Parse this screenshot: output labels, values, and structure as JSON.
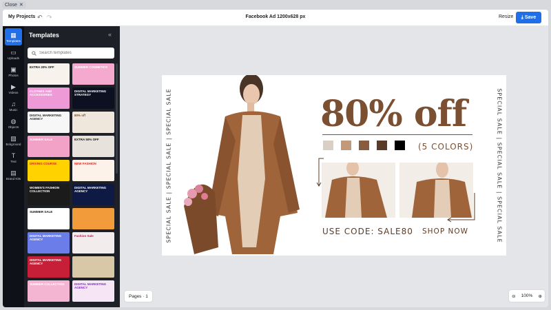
{
  "overlay": {
    "close_label": "Close",
    "close_icon": "close-icon"
  },
  "topbar": {
    "my_projects": "My Projects",
    "doc_title": "Facebook Ad 1200x628 px",
    "resize_label": "Resize",
    "save_label": "Save",
    "accent": "#1f6feb"
  },
  "rail": {
    "items": [
      {
        "label": "Templates",
        "icon": "grid-icon"
      },
      {
        "label": "Uploads",
        "icon": "folder-icon"
      },
      {
        "label": "Photos",
        "icon": "image-icon"
      },
      {
        "label": "Videos",
        "icon": "play-icon"
      },
      {
        "label": "Music",
        "icon": "music-icon"
      },
      {
        "label": "Objects",
        "icon": "shapes-icon"
      },
      {
        "label": "Bckground",
        "icon": "background-icon"
      },
      {
        "label": "Text",
        "icon": "text-icon"
      },
      {
        "label": "Brand Kits",
        "icon": "briefcase-icon"
      }
    ]
  },
  "panel": {
    "title": "Templates",
    "search_placeholder": "Search templates",
    "thumbs": [
      {
        "text": "EXTRA 20% OFF",
        "bg": "#f7f3ec",
        "fg": "#111"
      },
      {
        "text": "SUMMER COSMETICS",
        "bg": "#f5a9cf",
        "fg": "#fff"
      },
      {
        "text": "CLOTHES AND ACCESSORIES",
        "bg": "#ee9ad6",
        "fg": "#fff"
      },
      {
        "text": "DIGITAL MARKETING STRATEGY",
        "bg": "#0d1021",
        "fg": "#fff"
      },
      {
        "text": "DIGITAL MARKETING AGENCY",
        "bg": "#f7f7f7",
        "fg": "#222"
      },
      {
        "text": "80% off",
        "bg": "#efe6dc",
        "fg": "#7a4f32"
      },
      {
        "text": "SUMMER SALE",
        "bg": "#f2a2c6",
        "fg": "#fff"
      },
      {
        "text": "EXTRA 50% OFF",
        "bg": "#e7e3dc",
        "fg": "#111"
      },
      {
        "text": "DRIVING COURSE",
        "bg": "#ffd200",
        "fg": "#d9261c"
      },
      {
        "text": "NEW FASHION",
        "bg": "#fdf2e9",
        "fg": "#d9261c"
      },
      {
        "text": "WOMEN'S FASHION COLLECTION",
        "bg": "#1b1b1b",
        "fg": "#fff"
      },
      {
        "text": "DIGITAL MARKETING AGENCY",
        "bg": "#0f1a44",
        "fg": "#fff"
      },
      {
        "text": "SUMMER SALE",
        "bg": "#ffffff",
        "fg": "#111"
      },
      {
        "text": "",
        "bg": "#f29b3a",
        "fg": "#fff"
      },
      {
        "text": "DIGITAL MARKETING AGENCY",
        "bg": "#6a7de8",
        "fg": "#fff"
      },
      {
        "text": "Fashion Sale",
        "bg": "#f3ecec",
        "fg": "#c2185b"
      },
      {
        "text": "DIGITAL MARKETING AGENCY",
        "bg": "#c71f37",
        "fg": "#fff"
      },
      {
        "text": "",
        "bg": "#d9c8a7",
        "fg": "#5c3b26"
      },
      {
        "text": "SUMMER COLLECTION",
        "bg": "#f3b5d2",
        "fg": "#fff"
      },
      {
        "text": "DIGITAL MARKETING AGENCY",
        "bg": "#f6e6f5",
        "fg": "#7b2cbf"
      }
    ]
  },
  "ad": {
    "side_text": "SPECIAL SALE | SPECIAL SALE | SPECIAL SALE",
    "headline": "80% off",
    "colors_text": "(5 COLORS)",
    "swatches": [
      "#d9cfc4",
      "#c29a7a",
      "#8a5c3f",
      "#5a3a28",
      "#000000"
    ],
    "code_text": "USE CODE: SALE80",
    "shop_text": "SHOP NOW"
  },
  "footer": {
    "pages_label": "Pages · 1",
    "zoom_value": "100%"
  }
}
